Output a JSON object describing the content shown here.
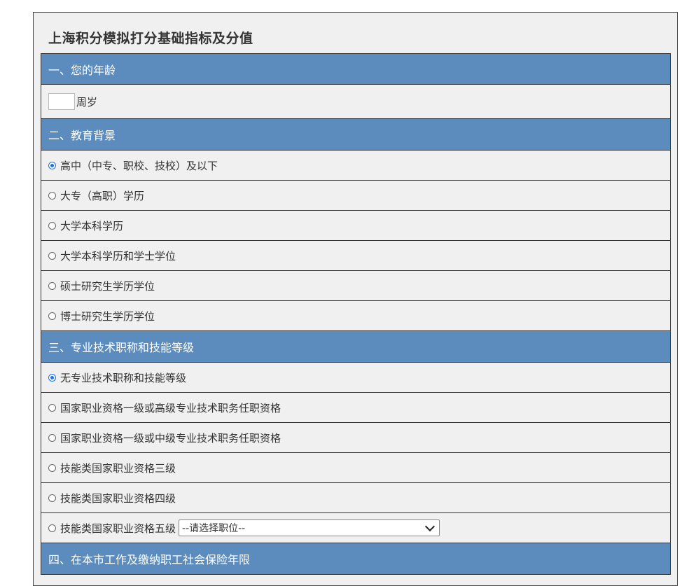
{
  "title": "上海积分模拟打分基础指标及分值",
  "sections": {
    "age": {
      "header": "一、您的年龄",
      "unit": "周岁",
      "value": ""
    },
    "education": {
      "header": "二、教育背景",
      "options": [
        {
          "label": "高中（中专、职校、技校）及以下",
          "checked": true
        },
        {
          "label": "大专（高职）学历",
          "checked": false
        },
        {
          "label": "大学本科学历",
          "checked": false
        },
        {
          "label": "大学本科学历和学士学位",
          "checked": false
        },
        {
          "label": "硕士研究生学历学位",
          "checked": false
        },
        {
          "label": "博士研究生学历学位",
          "checked": false
        }
      ]
    },
    "title_skill": {
      "header": "三、专业技术职称和技能等级",
      "options": [
        {
          "label": "无专业技术职称和技能等级",
          "checked": true
        },
        {
          "label": "国家职业资格一级或高级专业技术职务任职资格",
          "checked": false
        },
        {
          "label": "国家职业资格一级或中级专业技术职务任职资格",
          "checked": false
        },
        {
          "label": "技能类国家职业资格三级",
          "checked": false
        },
        {
          "label": "技能类国家职业资格四级",
          "checked": false
        },
        {
          "label": "技能类国家职业资格五级",
          "checked": false
        }
      ],
      "select_value": "--请选择职位--"
    },
    "social": {
      "header": "四、在本市工作及缴纳职工社会保险年限"
    }
  },
  "colors": {
    "header_bg": "#5b8cbd",
    "panel_bg": "#f0f0f0"
  }
}
